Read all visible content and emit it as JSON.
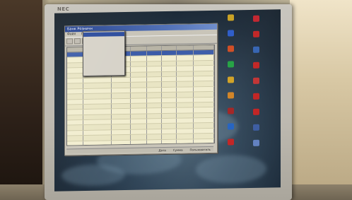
{
  "monitor": {
    "brand": "NEC"
  },
  "app": {
    "title": "Банк Розничн",
    "menu": [
      "Файл",
      "Правка",
      "Вид",
      "Сервис"
    ],
    "columns": [
      "",
      "",
      "",
      "",
      "",
      "",
      "",
      ""
    ],
    "status": [
      "Дата",
      "Сумма",
      "Пользователь"
    ]
  },
  "grid_rows": 23,
  "context_menu_items": 10,
  "desktop_icons": [
    {
      "label": "",
      "color": "#c8a020"
    },
    {
      "label": "",
      "color": "#c0202a"
    },
    {
      "label": "",
      "color": "#2a5ac8"
    },
    {
      "label": "",
      "color": "#c02020"
    },
    {
      "label": "",
      "color": "#d04a20"
    },
    {
      "label": "",
      "color": "#3060b0"
    },
    {
      "label": "",
      "color": "#20a040"
    },
    {
      "label": "",
      "color": "#c02020"
    },
    {
      "label": "",
      "color": "#d0a020"
    },
    {
      "label": "",
      "color": "#c03030"
    },
    {
      "label": "",
      "color": "#d08020"
    },
    {
      "label": "",
      "color": "#c02020"
    },
    {
      "label": "",
      "color": "#a02020"
    },
    {
      "label": "",
      "color": "#c02020"
    },
    {
      "label": "",
      "color": "#2060c0"
    },
    {
      "label": "",
      "color": "#3a5aa0"
    },
    {
      "label": "",
      "color": "#c02020"
    },
    {
      "label": "",
      "color": "#6080c0"
    }
  ]
}
